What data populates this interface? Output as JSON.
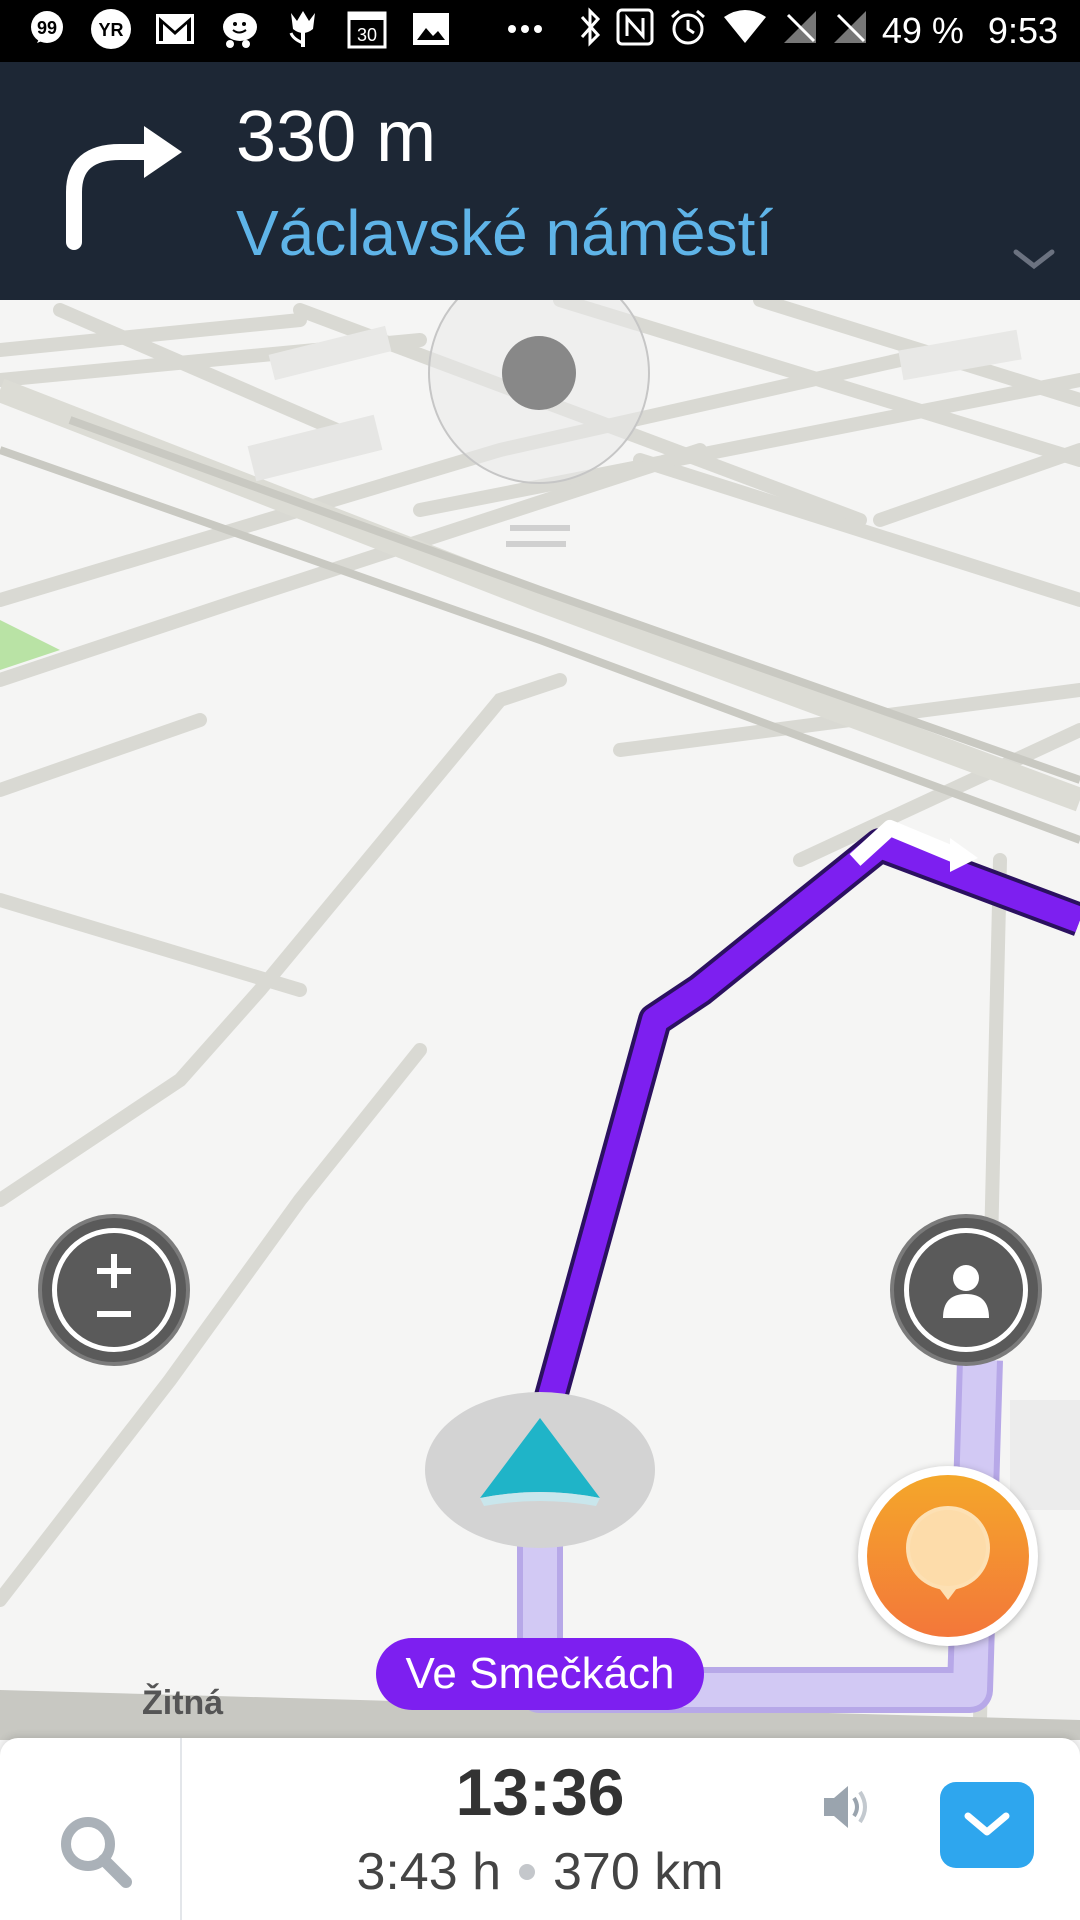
{
  "status_bar": {
    "icons": [
      "quote-chat-icon",
      "yr-app-icon",
      "gmail-icon",
      "waze-icon",
      "tulip-icon",
      "calendar-icon",
      "image-icon",
      "more-dots-icon",
      "bluetooth-icon",
      "nfc-icon",
      "alarm-icon",
      "wifi-icon",
      "no-signal-icon",
      "no-signal-icon"
    ],
    "calendar_day": "30",
    "yr_label": "YR",
    "battery": "49 %",
    "time": "9:53"
  },
  "nav_banner": {
    "distance": "330 m",
    "street": "Václavské náměstí",
    "turn_icon": "turn-right-icon",
    "colors": {
      "background": "#1d2735",
      "street": "#5fb4e8"
    }
  },
  "map": {
    "current_street": "Ve Smečkách",
    "side_street": "Žitná",
    "colors": {
      "route": "#7d1ff0",
      "route_passed": "#cfc6f0",
      "vehicle": "#1fb4c8"
    }
  },
  "bottom_panel": {
    "eta": "13:36",
    "duration": "3:43 h",
    "distance": "370 km",
    "colors": {
      "expand_button": "#2ea6ee"
    }
  }
}
